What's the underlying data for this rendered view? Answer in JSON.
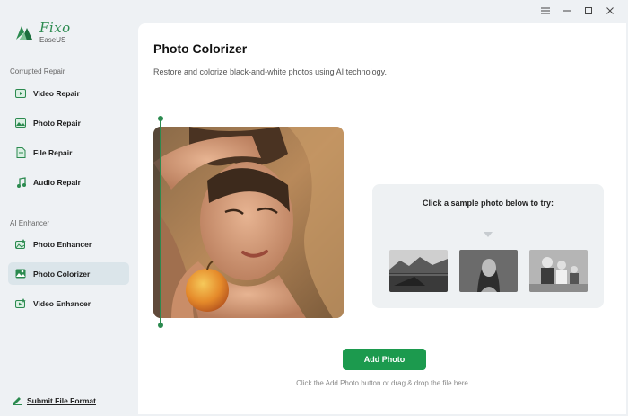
{
  "app": {
    "logo_name": "Fixo",
    "logo_sub": "EaseUS"
  },
  "window_controls": [
    "menu-icon",
    "minimize-icon",
    "maximize-icon",
    "close-icon"
  ],
  "sidebar": {
    "sections": [
      {
        "label": "Corrupted Repair"
      },
      {
        "label": "AI Enhancer"
      }
    ],
    "items": [
      {
        "label": "Video Repair",
        "icon": "video-repair-icon"
      },
      {
        "label": "Photo Repair",
        "icon": "photo-repair-icon"
      },
      {
        "label": "File Repair",
        "icon": "file-repair-icon"
      },
      {
        "label": "Audio Repair",
        "icon": "audio-repair-icon"
      },
      {
        "label": "Photo Enhancer",
        "icon": "photo-enhancer-icon"
      },
      {
        "label": "Photo Colorizer",
        "icon": "photo-colorizer-icon",
        "active": true
      },
      {
        "label": "Video Enhancer",
        "icon": "video-enhancer-icon"
      }
    ],
    "submit_label": "Submit File Format"
  },
  "main": {
    "title": "Photo Colorizer",
    "subtitle": "Restore and colorize black-and-white photos using AI technology.",
    "sample_title": "Click a sample photo below to try:",
    "samples": [
      "sample-photo-landscape",
      "sample-photo-woman",
      "sample-photo-family"
    ],
    "add_button": "Add Photo",
    "hint": "Click the Add Photo button or drag & drop the file here"
  },
  "colors": {
    "accent": "#1c9a4e",
    "sidebar_bg": "#eef1f4",
    "active_item_bg": "#dbe5ea"
  }
}
